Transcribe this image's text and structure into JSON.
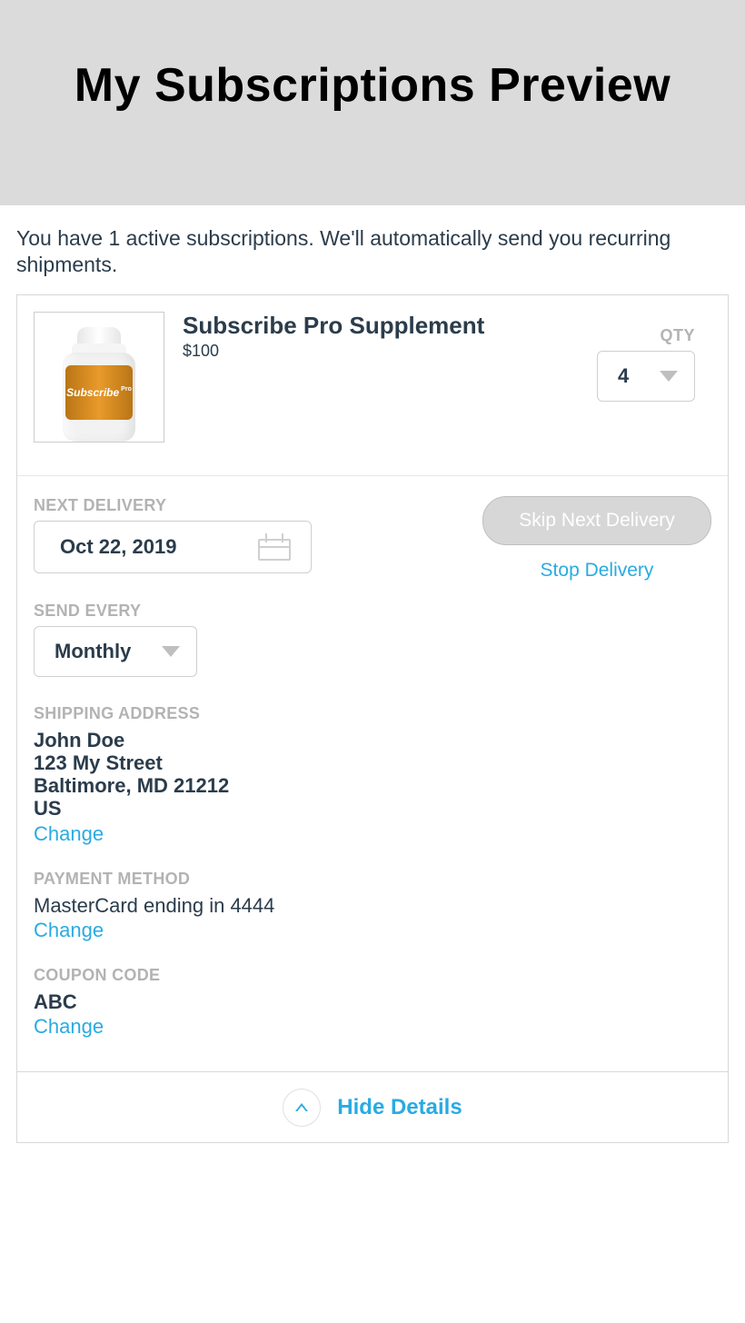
{
  "banner": {
    "title": "My Subscriptions Preview"
  },
  "intro": "You have 1 active subscriptions. We'll automatically send you recurring shipments.",
  "product": {
    "name": "Subscribe Pro Supplement",
    "price": "$100",
    "image_label": "Subscribe",
    "image_label_suffix": "Pro",
    "qty_label": "QTY",
    "qty_value": "4"
  },
  "delivery": {
    "label": "NEXT DELIVERY",
    "date": "Oct 22, 2019",
    "skip_label": "Skip Next Delivery",
    "stop_label": "Stop Delivery"
  },
  "frequency": {
    "label": "SEND EVERY",
    "value": "Monthly"
  },
  "shipping": {
    "label": "SHIPPING ADDRESS",
    "name": "John Doe",
    "street": "123 My Street",
    "city_line": "Baltimore, MD 21212",
    "country": "US",
    "change": "Change"
  },
  "payment": {
    "label": "PAYMENT METHOD",
    "text": "MasterCard ending in 4444",
    "change": "Change"
  },
  "coupon": {
    "label": "COUPON CODE",
    "code": "ABC",
    "change": "Change"
  },
  "footer": {
    "hide_label": "Hide Details"
  }
}
